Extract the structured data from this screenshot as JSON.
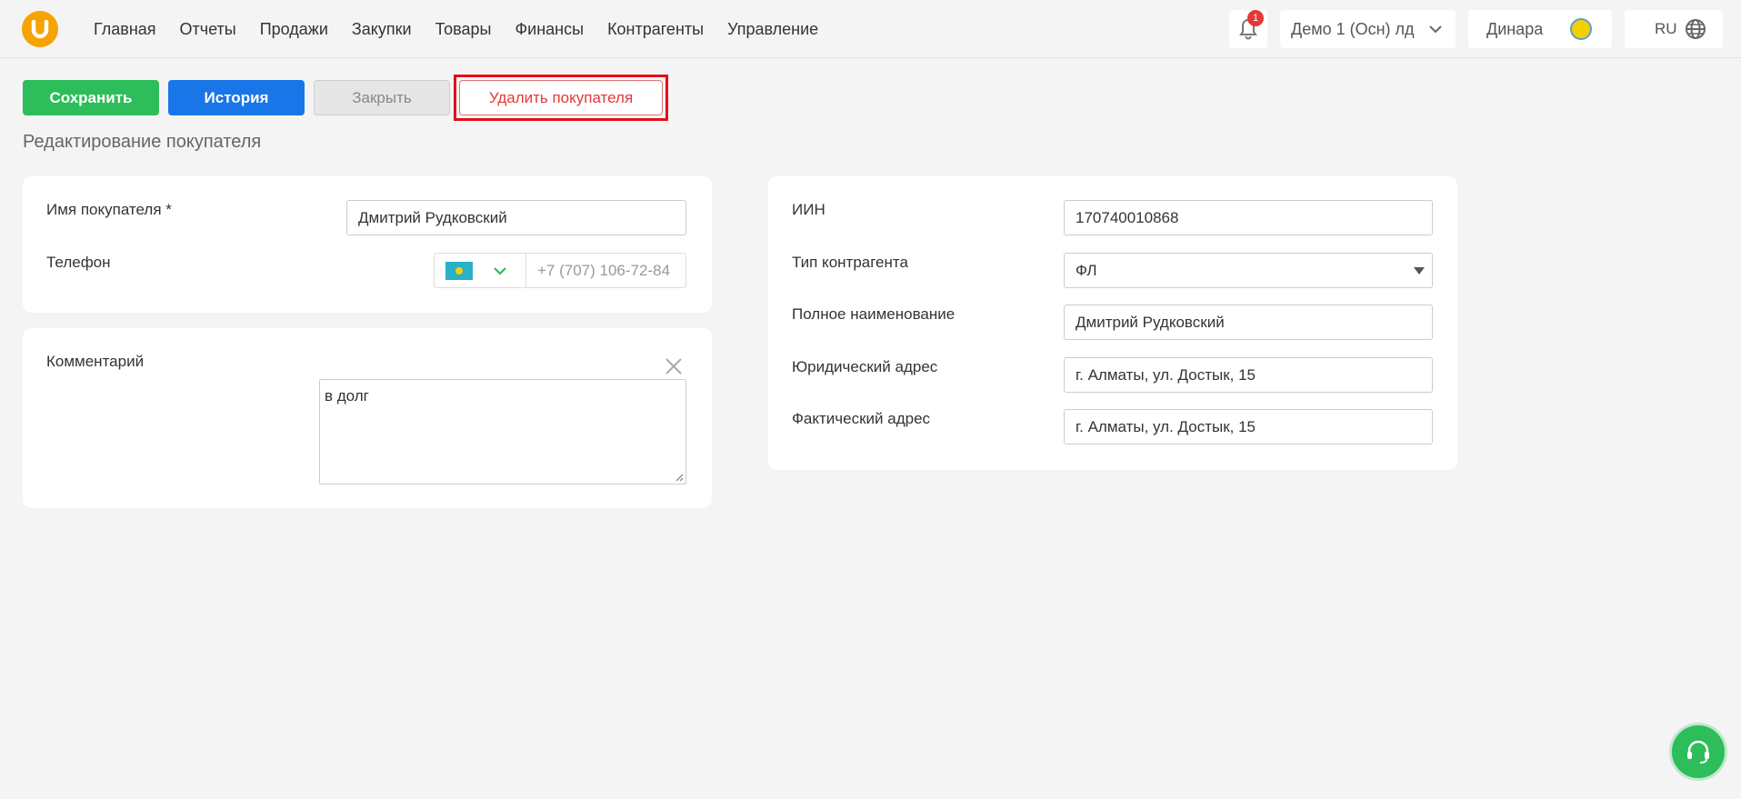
{
  "nav": {
    "items": [
      "Главная",
      "Отчеты",
      "Продажи",
      "Закупки",
      "Товары",
      "Финансы",
      "Контрагенты",
      "Управление"
    ]
  },
  "header": {
    "notifications_count": "1",
    "store": "Демо 1 (Осн) лд",
    "user": "Динара",
    "language": "RU"
  },
  "toolbar": {
    "save_label": "Сохранить",
    "history_label": "История",
    "close_label": "Закрыть",
    "delete_label": "Удалить покупателя"
  },
  "page": {
    "title": "Редактирование покупателя"
  },
  "customer": {
    "name_label": "Имя покупателя *",
    "name_value": "Дмитрий Рудковский",
    "phone_label": "Телефон",
    "phone_value": "+7 (707) 106-72-84"
  },
  "comment": {
    "label": "Комментарий",
    "value": "в долг"
  },
  "details": {
    "iin_label": "ИИН",
    "iin_value": "170740010868",
    "type_label": "Тип контрагента",
    "type_value": "ФЛ",
    "fullname_label": "Полное наименование",
    "fullname_value": "Дмитрий Рудковский",
    "legal_address_label": "Юридический адрес",
    "legal_address_value": "г. Алматы, ул. Достык, 15",
    "actual_address_label": "Фактический адрес",
    "actual_address_value": "г. Алматы, ул. Достык, 15"
  },
  "colors": {
    "accent_green": "#2dbd5a",
    "accent_blue": "#1976e8",
    "danger_red": "#e53935",
    "logo_orange": "#f5a300"
  },
  "icons": [
    "logo-icon",
    "bell-icon",
    "chevron-down-icon",
    "avatar-icon",
    "globe-icon",
    "kz-flag-icon",
    "close-icon",
    "resize-handle-icon",
    "select-arrow-icon",
    "headset-icon"
  ]
}
